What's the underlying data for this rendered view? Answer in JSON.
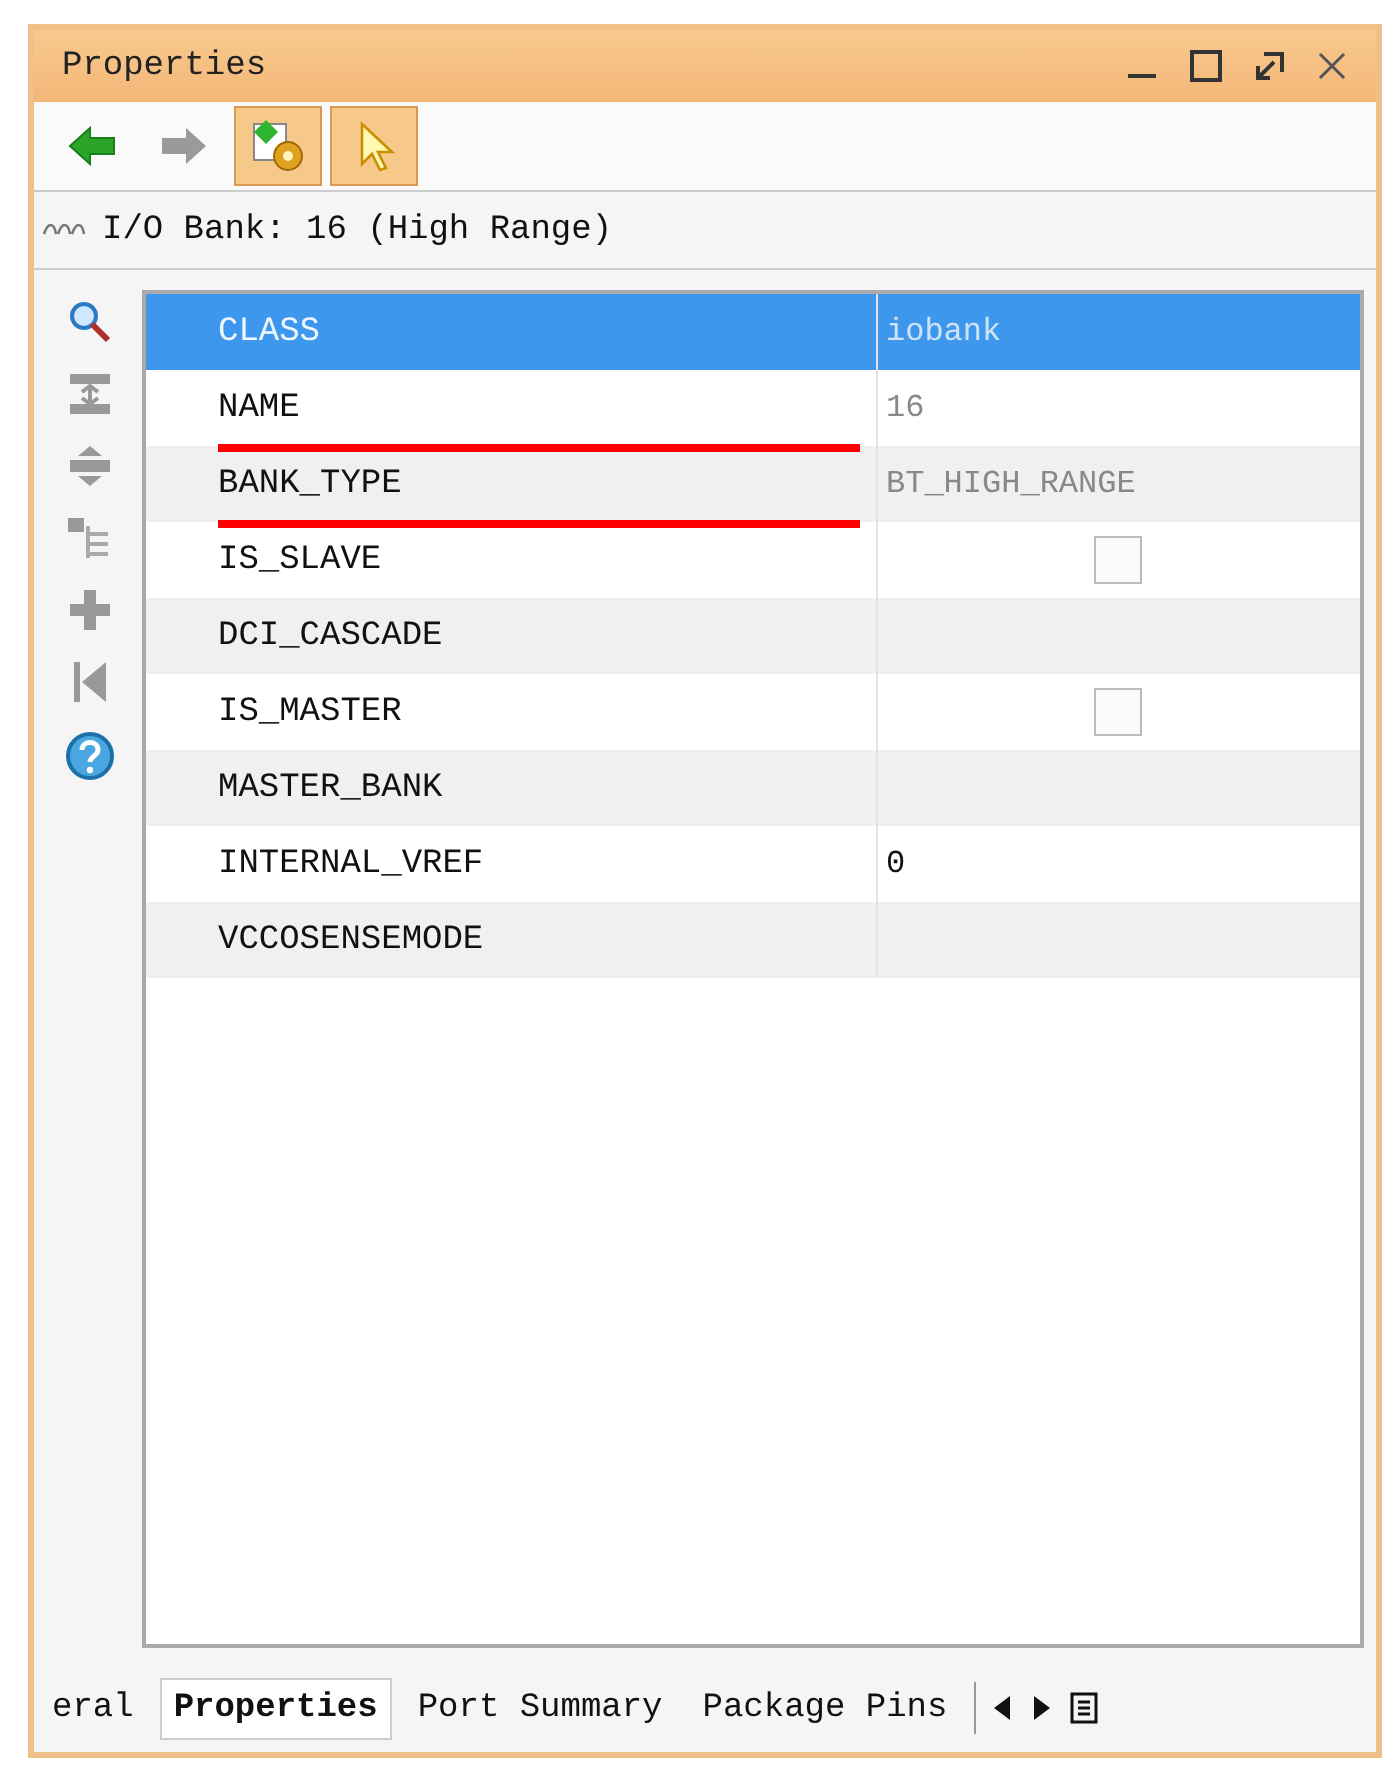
{
  "window": {
    "title": "Properties"
  },
  "toolbar": [
    {
      "kind": "back",
      "selected": false
    },
    {
      "kind": "forward",
      "selected": false
    },
    {
      "kind": "objects",
      "selected": true
    },
    {
      "kind": "pointer",
      "selected": true
    }
  ],
  "header": {
    "text": "I/O Bank: 16 (High Range)"
  },
  "side_tools": [
    {
      "kind": "search"
    },
    {
      "kind": "collapse"
    },
    {
      "kind": "expand"
    },
    {
      "kind": "group"
    },
    {
      "kind": "add"
    },
    {
      "kind": "first"
    },
    {
      "kind": "help"
    }
  ],
  "rows": [
    {
      "name": "CLASS",
      "kind": "text",
      "value": "iobank",
      "read_only": true,
      "selected": true,
      "marked": false
    },
    {
      "name": "NAME",
      "kind": "text",
      "value": "16",
      "read_only": true,
      "selected": false,
      "marked": true
    },
    {
      "name": "BANK_TYPE",
      "kind": "text",
      "value": "BT_HIGH_RANGE",
      "read_only": true,
      "selected": false,
      "marked": true
    },
    {
      "name": "IS_SLAVE",
      "kind": "checkbox",
      "checked": false,
      "selected": false,
      "marked": false
    },
    {
      "name": "DCI_CASCADE",
      "kind": "empty",
      "selected": false,
      "marked": false
    },
    {
      "name": "IS_MASTER",
      "kind": "checkbox",
      "checked": false,
      "selected": false,
      "marked": false
    },
    {
      "name": "MASTER_BANK",
      "kind": "empty",
      "selected": false,
      "marked": false
    },
    {
      "name": "INTERNAL_VREF",
      "kind": "text",
      "value": "0",
      "read_only": false,
      "selected": false,
      "marked": false
    },
    {
      "name": "VCCOSENSEMODE",
      "kind": "empty",
      "selected": false,
      "marked": false
    }
  ],
  "tabs": [
    {
      "label": "eral",
      "selected": false
    },
    {
      "label": "Properties",
      "selected": true
    },
    {
      "label": "Port Summary",
      "selected": false
    },
    {
      "label": "Package Pins",
      "selected": false
    }
  ]
}
